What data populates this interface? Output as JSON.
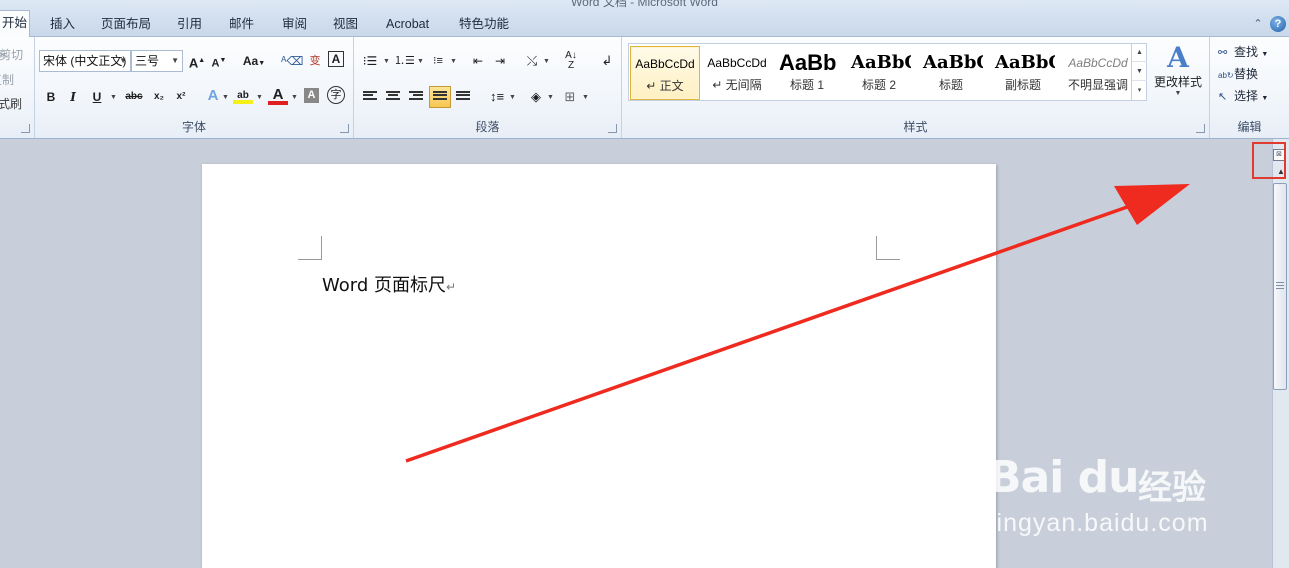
{
  "window": {
    "title": "Word 文档 - Microsoft Word"
  },
  "tabs": [
    {
      "label": "开始",
      "active": true
    },
    {
      "label": "插入"
    },
    {
      "label": "页面布局"
    },
    {
      "label": "引用"
    },
    {
      "label": "邮件"
    },
    {
      "label": "审阅"
    },
    {
      "label": "视图"
    },
    {
      "label": "Acrobat"
    },
    {
      "label": "特色功能"
    }
  ],
  "clipboard": {
    "items": [
      "剪切",
      "复制",
      "格式刷"
    ]
  },
  "font_group": {
    "label": "字体",
    "font_name": "宋体 (中文正文)",
    "font_size": "三号",
    "grow": "A",
    "shrink": "A",
    "change_case": "Aa",
    "bold": "B",
    "italic": "I",
    "underline": "U",
    "strike": "abc",
    "subscript": "x₂",
    "superscript": "x²",
    "font_color": "A",
    "char_shade": "A",
    "enclose": "字"
  },
  "paragraph_group": {
    "label": "段落"
  },
  "styles_group": {
    "label": "样式",
    "items": [
      {
        "preview": "AaBbCcDd",
        "name": "↵ 正文",
        "selected": true
      },
      {
        "preview": "AaBbCcDd",
        "name": "↵ 无间隔"
      },
      {
        "preview": "AaBb",
        "name": "标题 1"
      },
      {
        "preview": "AaBbC",
        "name": "标题 2"
      },
      {
        "preview": "AaBbC",
        "name": "标题"
      },
      {
        "preview": "AaBbC",
        "name": "副标题"
      },
      {
        "preview": "AaBbCcDd",
        "name": "不明显强调"
      }
    ],
    "change_styles": "更改样式"
  },
  "editing_group": {
    "label": "编辑",
    "find": "查找",
    "replace": "替换",
    "select": "选择"
  },
  "document": {
    "text": "Word 页面标尺",
    "para_mark": "↵"
  },
  "watermark": {
    "logo": "Bai du",
    "cn": "经验",
    "url": "jingyan.baidu.com"
  },
  "colors": {
    "highlight_box": "#e23a2f",
    "arrow": "#ef2a1f",
    "accent": "#2b579a"
  },
  "icons": {
    "help": "help-icon",
    "ruler": "view-ruler-icon",
    "find": "binoculars-icon",
    "replace": "replace-icon",
    "select": "cursor-icon"
  }
}
